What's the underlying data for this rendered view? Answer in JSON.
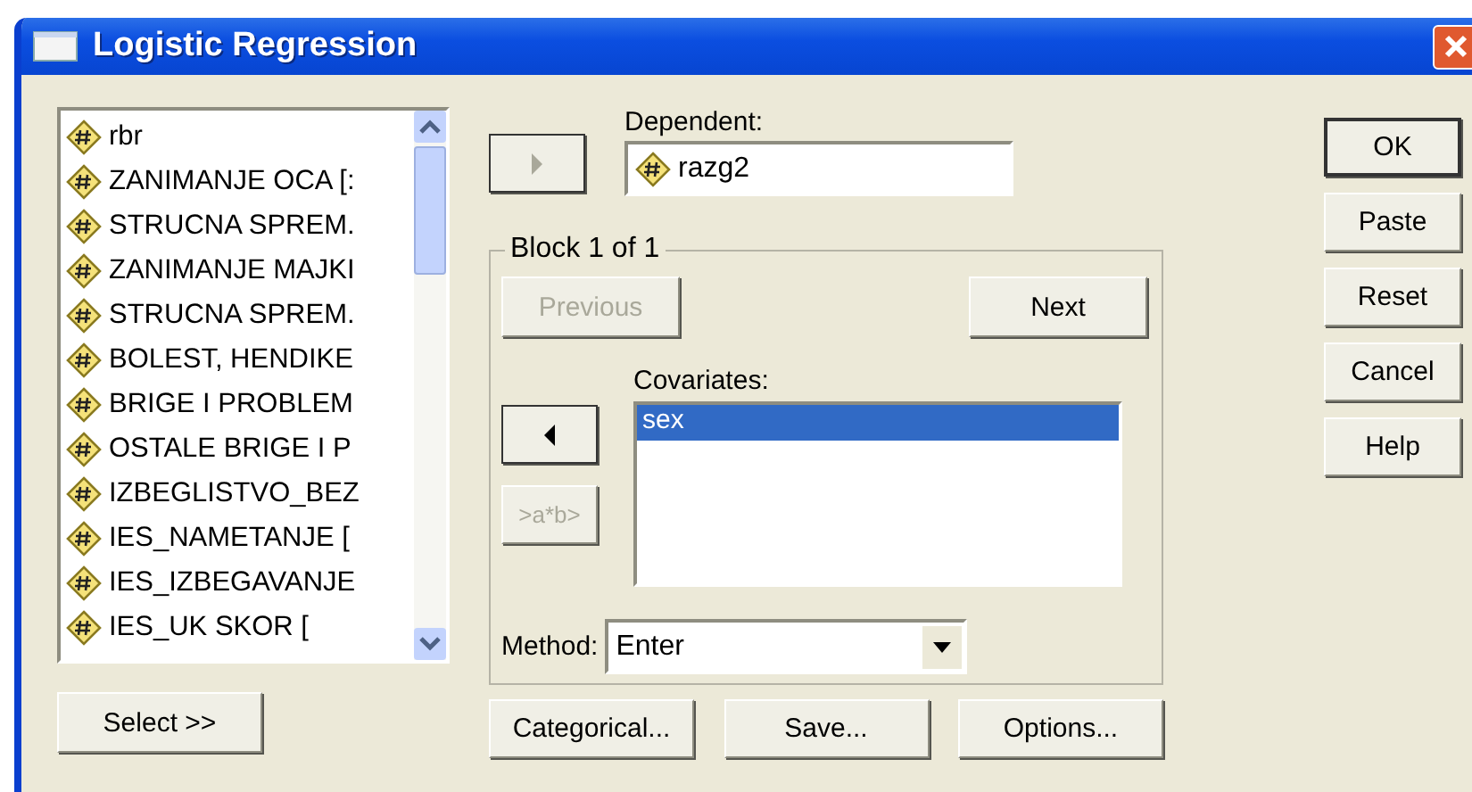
{
  "window": {
    "title": "Logistic Regression"
  },
  "variables": [
    {
      "label": "rbr",
      "selected": false
    },
    {
      "label": "ZANIMANJE OCA [:",
      "selected": false
    },
    {
      "label": "STRUCNA SPREM.",
      "selected": false
    },
    {
      "label": "ZANIMANJE MAJKI",
      "selected": false
    },
    {
      "label": "STRUCNA SPREM.",
      "selected": false
    },
    {
      "label": "BOLEST, HENDIKE",
      "selected": false
    },
    {
      "label": "BRIGE I PROBLEM",
      "selected": false
    },
    {
      "label": "OSTALE BRIGE I P",
      "selected": false
    },
    {
      "label": "IZBEGLISTVO_BEZ",
      "selected": false
    },
    {
      "label": "IES_NAMETANJE [",
      "selected": false
    },
    {
      "label": "IES_IZBEGAVANJE",
      "selected": false
    },
    {
      "label": "IES_UK SKOR [",
      "selected": false
    }
  ],
  "select_button": "Select >>",
  "move_dependent_button": {
    "disabled": true
  },
  "dependent": {
    "label": "Dependent:",
    "value": "razg2"
  },
  "block": {
    "title": "Block 1 of 1",
    "previous": {
      "label": "Previous",
      "disabled": true
    },
    "next": {
      "label": "Next",
      "disabled": false
    },
    "move_covariate_button": {
      "disabled": false
    },
    "interaction_button": {
      "label": ">a*b>",
      "disabled": true
    },
    "covariates": {
      "label": "Covariates:",
      "items": [
        {
          "label": "sex",
          "selected": true
        }
      ]
    },
    "method": {
      "label": "Method:",
      "value": "Enter"
    }
  },
  "bottom_buttons": [
    "Categorical...",
    "Save...",
    "Options..."
  ],
  "side_buttons": [
    {
      "label": "OK",
      "default": true
    },
    {
      "label": "Paste",
      "default": false
    },
    {
      "label": "Reset",
      "default": false
    },
    {
      "label": "Cancel",
      "default": false
    },
    {
      "label": "Help",
      "default": false
    }
  ]
}
